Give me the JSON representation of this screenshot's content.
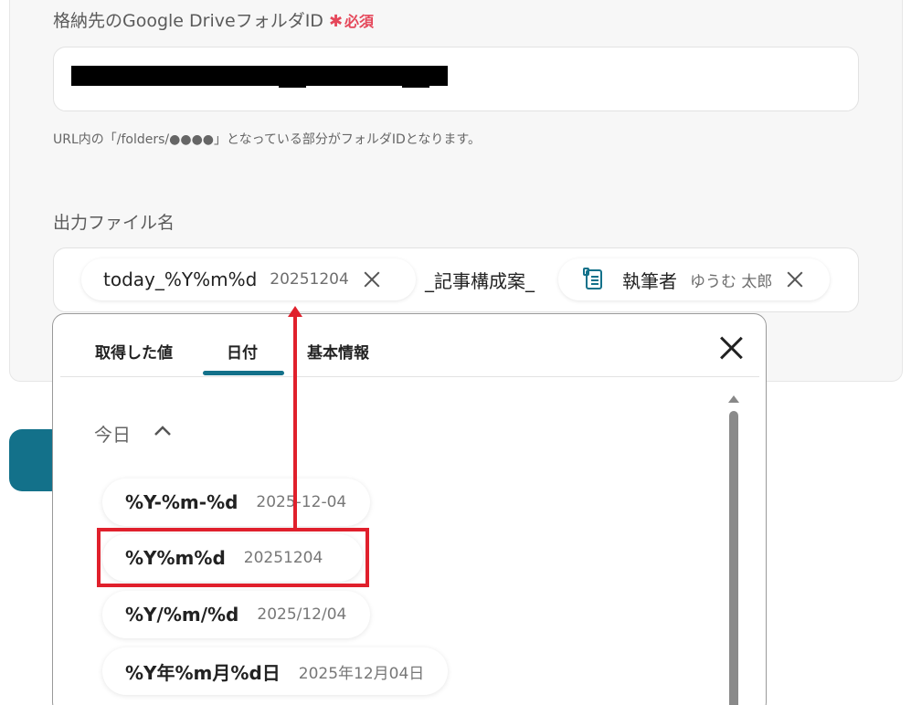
{
  "folder_field": {
    "label": "格納先のGoogle DriveフォルダID",
    "required_star": "✱",
    "required_text": "必須",
    "hint": "URL内の「/folders/●●●●」となっている部分がフォルダIDとなります。"
  },
  "filename_field": {
    "label": "出力ファイル名",
    "chips": [
      {
        "main": "today_%Y%m%d",
        "sub": "20251204"
      },
      {
        "main": "執筆者",
        "sub": "ゆうむ 太郎"
      }
    ],
    "separator_text": "_記事構成案_"
  },
  "popup": {
    "tabs": [
      {
        "label": "取得した値"
      },
      {
        "label": "日付"
      },
      {
        "label": "基本情報"
      }
    ],
    "active_tab": "日付",
    "section_title": "今日",
    "options": [
      {
        "main": "%Y-%m-%d",
        "sub": "2025-12-04"
      },
      {
        "main": "%Y%m%d",
        "sub": "20251204"
      },
      {
        "main": "%Y/%m/%d",
        "sub": "2025/12/04"
      },
      {
        "main": "%Y年%m月%d日",
        "sub": "2025年12月04日"
      }
    ]
  },
  "colors": {
    "accent": "#13718a",
    "required": "#e5475a",
    "annotation": "#e0202c"
  }
}
